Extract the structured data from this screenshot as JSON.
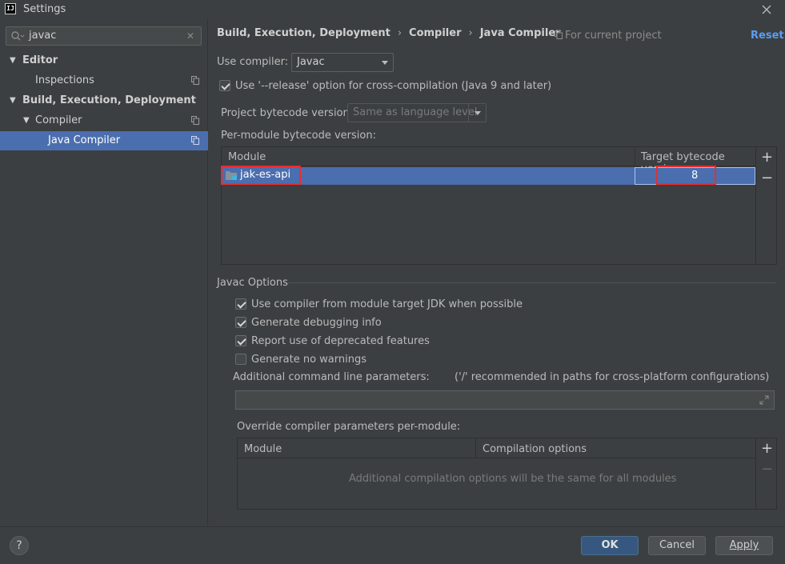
{
  "window": {
    "title": "Settings",
    "app_icon_text": "IJ",
    "close_icon": "close-icon"
  },
  "sidebar": {
    "search": {
      "value": "javac",
      "icon": "search-icon",
      "clear_icon": "clear-icon"
    },
    "items": [
      {
        "label": "Editor",
        "expanded": true,
        "bold": true
      },
      {
        "label": "Inspections",
        "copy_icon": true
      },
      {
        "label": "Build, Execution, Deployment",
        "expanded": true,
        "bold": true
      },
      {
        "label": "Compiler",
        "expanded": true,
        "copy_icon": true
      },
      {
        "label": "Java Compiler",
        "selected": true,
        "copy_icon": true
      }
    ]
  },
  "header": {
    "breadcrumb": [
      "Build, Execution, Deployment",
      "Compiler",
      "Java Compiler"
    ],
    "breadcrumb_sep": "›",
    "for_current_project": "For current project",
    "reset": "Reset"
  },
  "compiler": {
    "use_compiler_label": "Use compiler:",
    "use_compiler_value": "Javac",
    "release_option_label": "Use '--release' option for cross-compilation (Java 9 and later)",
    "release_option_checked": true,
    "project_bytecode_label": "Project bytecode version:",
    "project_bytecode_value": "Same as language level",
    "per_module_label": "Per-module bytecode version:"
  },
  "module_table": {
    "headers": [
      "Module",
      "Target bytecode version"
    ],
    "rows": [
      {
        "module": "jak-es-api",
        "target": "8"
      }
    ],
    "add": "+",
    "remove": "−"
  },
  "javac_options": {
    "section_title": "Javac Options",
    "checkboxes": [
      {
        "label": "Use compiler from module target JDK when possible",
        "checked": true
      },
      {
        "label": "Generate debugging info",
        "checked": true
      },
      {
        "label": "Report use of deprecated features",
        "checked": true
      },
      {
        "label": "Generate no warnings",
        "checked": false
      }
    ],
    "cmd_label": "Additional command line parameters:",
    "cmd_hint": "('/' recommended in paths for cross-platform configurations)",
    "cmd_value": "",
    "override_label": "Override compiler parameters per-module:",
    "override_headers": [
      "Module",
      "Compilation options"
    ],
    "override_empty": "Additional compilation options will be the same for all modules",
    "add": "+",
    "remove": "−"
  },
  "footer": {
    "help": "?",
    "ok": "OK",
    "cancel": "Cancel",
    "apply": "Apply"
  },
  "colors": {
    "selection": "#4b6eaf",
    "link": "#589df6",
    "highlight_box": "#ee2b2b",
    "background": "#3c3f41"
  }
}
